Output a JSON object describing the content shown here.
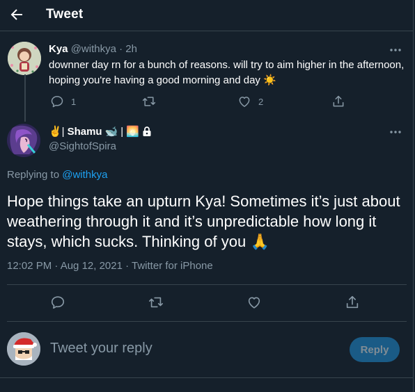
{
  "header": {
    "title": "Tweet"
  },
  "parent_tweet": {
    "display_name": "Kya",
    "handle": "@withkya",
    "separator": "·",
    "time": "2h",
    "text": "downner day rn for a bunch of reasons. will try to aim higher in the afternoon, hoping you're having a good morning and day",
    "text_emoji": "☀️",
    "reply_count": "1",
    "retweet_count": "",
    "like_count": "2"
  },
  "main_tweet": {
    "display_name_prefix": "✌️|",
    "display_name": "Shamu",
    "display_name_emoji": "🐋",
    "display_name_suffix": "|",
    "display_name_emoji2": "🌅",
    "lock_icon": "lock-icon",
    "handle": "@SightofSpira",
    "replying_label": "Replying to",
    "replying_to": "@withkya",
    "text": "Hope things take an upturn Kya! Sometimes it’s just about weathering through it and it’s unpredictable how long it stays, which sucks. Thinking of you",
    "text_emoji": "🙏",
    "timestamp": "12:02 PM · Aug 12, 2021 · Twitter for iPhone"
  },
  "reply_box": {
    "placeholder": "Tweet your reply",
    "button_label": "Reply"
  },
  "colors": {
    "background": "#15202b",
    "border": "#38444d",
    "muted": "#8899a6",
    "accent": "#1da1f2",
    "reply_button_disabled": "#1a5b86"
  }
}
